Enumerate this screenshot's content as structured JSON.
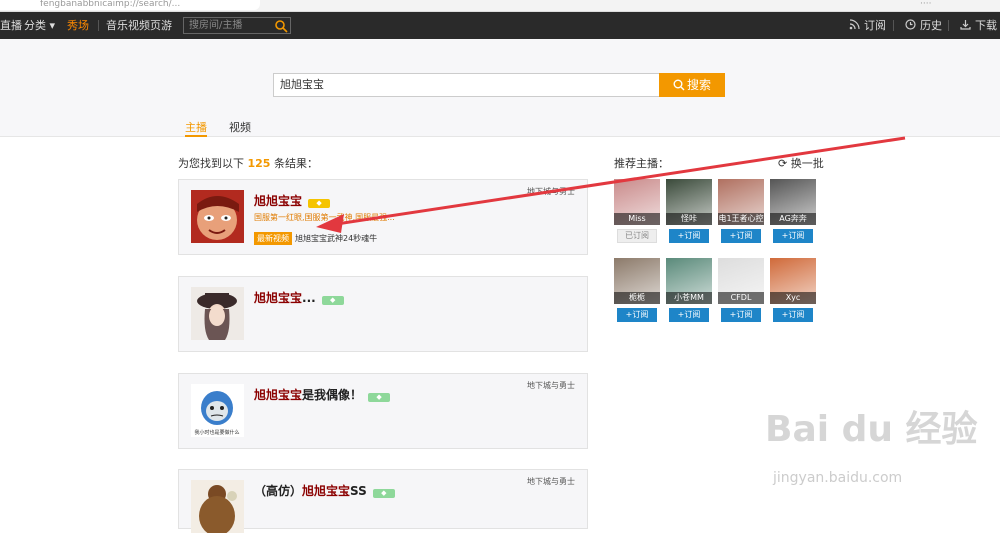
{
  "browser": {
    "url": "fengbanabbnicaimp://search/...",
    "ext": "····"
  },
  "topnav": {
    "live": "直播",
    "category": "分类",
    "showroom": "秀场",
    "music_video": "音乐视频页游",
    "search_placeholder": "搜房间/主播",
    "subscribe": "订阅",
    "history": "历史",
    "download": "下载",
    "accent_color": "#ff8a00"
  },
  "search": {
    "value": "旭旭宝宝",
    "button": "搜索",
    "tabs": [
      "主播",
      "视频"
    ]
  },
  "results": {
    "prefix": "为您找到以下",
    "count": "125",
    "suffix": "条结果：",
    "items": [
      {
        "name_hl": "旭旭宝宝",
        "name_rest": "",
        "game": "地下城与勇士",
        "desc": "国服第一红眼,国服第一武神,国服最强...",
        "latest_label": "最新视频",
        "latest_title": "旭旭宝宝武神24秒魂牛",
        "badge_color": "#f5c400",
        "avatar": "cartoon-red"
      },
      {
        "name_hl": "旭旭宝宝",
        "name_rest": "...",
        "game": "",
        "badge_color": "#8ed89a",
        "avatar": "girl-hat"
      },
      {
        "name_hl": "旭旭宝宝",
        "name_rest": "是我偶像！",
        "game": "地下城与勇士",
        "badge_color": "#8ed89a",
        "avatar": "cartoon-blue",
        "avatar_caption": "我小时也是要做什么"
      },
      {
        "name_pre": "（高仿）",
        "name_hl": "旭旭宝宝",
        "name_rest": "SS",
        "game": "地下城与勇士",
        "badge_color": "#8ed89a",
        "avatar": "hair-bun"
      }
    ]
  },
  "recommend": {
    "title": "推荐主播：",
    "refresh": "换一批",
    "subscribed_label": "已订阅",
    "subscribe_label": "+订阅",
    "anchors": [
      {
        "name": "Miss",
        "subscribed": true,
        "color": "#c98a8a"
      },
      {
        "name": "怪咔",
        "subscribed": false,
        "color": "#3a4a3a"
      },
      {
        "name": "电1王者心控",
        "subscribed": false,
        "color": "#b07060"
      },
      {
        "name": "AG奔奔",
        "subscribed": false,
        "color": "#555555"
      },
      {
        "name": "栀栀",
        "subscribed": false,
        "color": "#8c7a6a"
      },
      {
        "name": "小苍MM",
        "subscribed": false,
        "color": "#5a8a7a"
      },
      {
        "name": "CFDL",
        "subscribed": false,
        "color": "#dddddd"
      },
      {
        "name": "Xyc",
        "subscribed": false,
        "color": "#d06a3a"
      }
    ]
  },
  "watermark": {
    "logo": "Bai du 经验",
    "url": "jingyan.baidu.com"
  }
}
